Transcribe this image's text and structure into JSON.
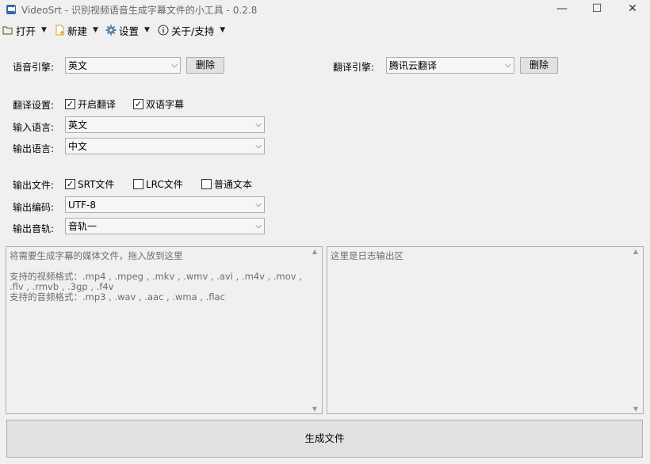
{
  "window": {
    "title": "VideoSrt - 识别视频语音生成字幕文件的小工具 - 0.2.8",
    "minimize": "—",
    "maximize": "☐",
    "close": "✕"
  },
  "menu": {
    "open": "打开",
    "new": "新建",
    "settings": "设置",
    "about": "关于/支持"
  },
  "engine": {
    "speech_label": "语音引擎:",
    "speech_value": "英文",
    "speech_delete": "删除",
    "translate_label": "翻译引擎:",
    "translate_value": "腾讯云翻译",
    "translate_delete": "删除"
  },
  "translation": {
    "settings_label": "翻译设置:",
    "enable_translate": "开启翻译",
    "enable_translate_checked": true,
    "bilingual": "双语字幕",
    "bilingual_checked": true,
    "input_lang_label": "输入语言:",
    "input_lang_value": "英文",
    "output_lang_label": "输出语言:",
    "output_lang_value": "中文"
  },
  "output": {
    "file_label": "输出文件:",
    "srt": "SRT文件",
    "srt_checked": true,
    "lrc": "LRC文件",
    "lrc_checked": false,
    "txt": "普通文本",
    "txt_checked": false,
    "encoding_label": "输出编码:",
    "encoding_value": "UTF-8",
    "track_label": "输出音轨:",
    "track_value": "音轨一"
  },
  "drop_panel": {
    "hint": "将需要生成字幕的媒体文件，拖入放到这里",
    "video_formats": "支持的视频格式：.mp4 , .mpeg , .mkv , .wmv , .avi , .m4v , .mov , .flv , .rmvb , .3gp , .f4v",
    "audio_formats": "支持的音频格式：.mp3 , .wav , .aac , .wma , .flac"
  },
  "log_panel": {
    "hint": "这里是日志输出区"
  },
  "generate_button": "生成文件"
}
